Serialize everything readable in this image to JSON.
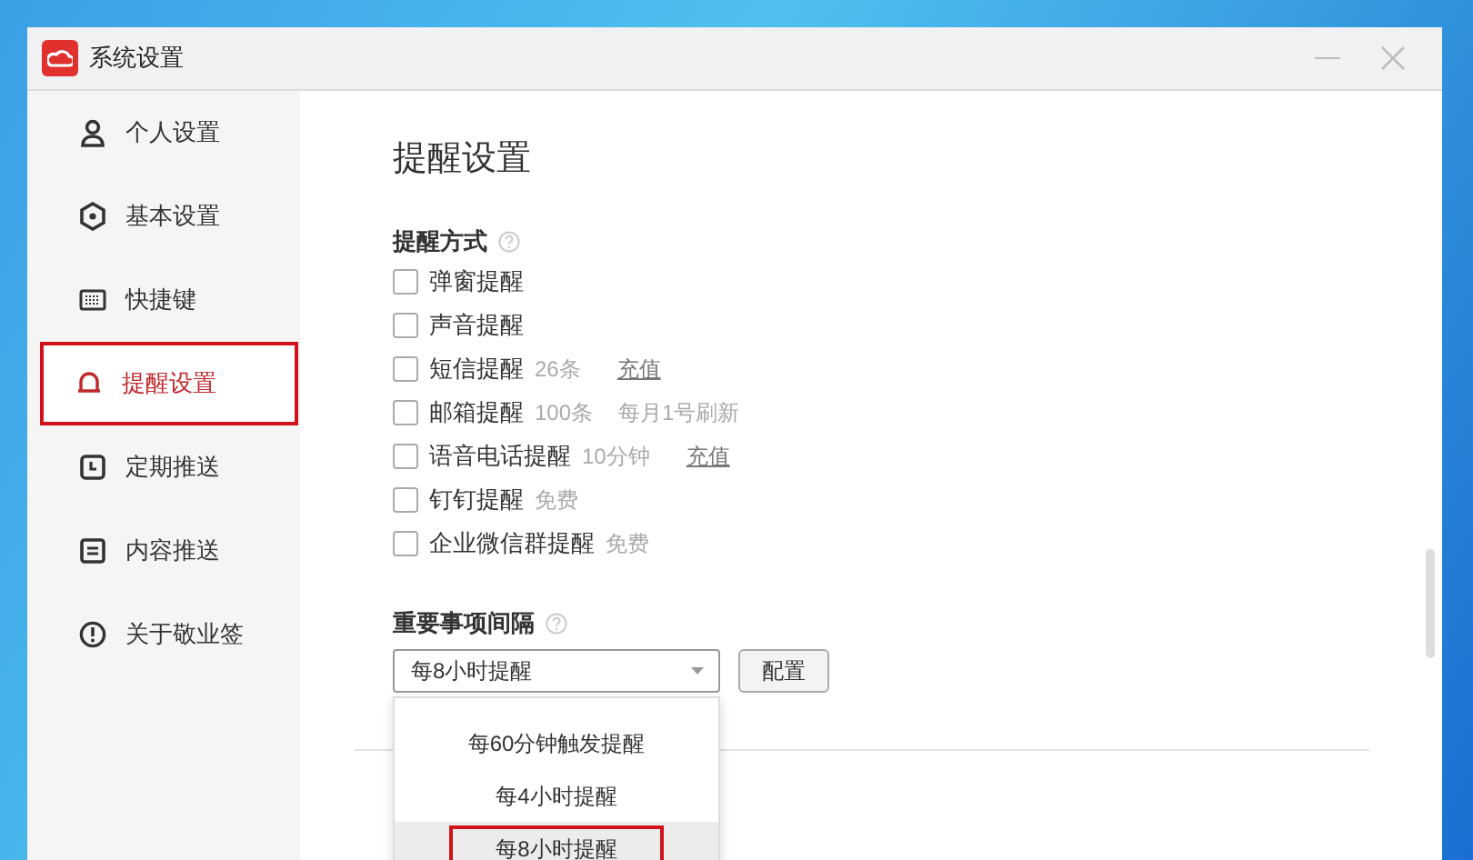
{
  "window": {
    "title": "系统设置"
  },
  "sidebar": {
    "items": [
      {
        "label": "个人设置",
        "selected": false
      },
      {
        "label": "基本设置",
        "selected": false
      },
      {
        "label": "快捷键",
        "selected": false
      },
      {
        "label": "提醒设置",
        "selected": true
      },
      {
        "label": "定期推送",
        "selected": false
      },
      {
        "label": "内容推送",
        "selected": false
      },
      {
        "label": "关于敬业签",
        "selected": false
      }
    ]
  },
  "page_title": "提醒设置",
  "methods": {
    "heading": "提醒方式",
    "options": [
      {
        "label": "弹窗提醒",
        "checked": false
      },
      {
        "label": "声音提醒",
        "checked": false
      },
      {
        "label": "短信提醒",
        "checked": false,
        "note": "26条",
        "link": "充值"
      },
      {
        "label": "邮箱提醒",
        "checked": false,
        "note": "100条",
        "note_2": "每月1号刷新"
      },
      {
        "label": "语音电话提醒",
        "checked": false,
        "note": "10分钟",
        "link": "充值"
      },
      {
        "label": "钉钉提醒",
        "checked": false,
        "note": "免费"
      },
      {
        "label": "企业微信群提醒",
        "checked": false,
        "note": "免费"
      }
    ]
  },
  "interval": {
    "heading": "重要事项间隔",
    "value": "每8小时提醒",
    "expanded": true,
    "button": "配置",
    "options": [
      {
        "label": "每60分钟触发提醒",
        "selected": false
      },
      {
        "label": "每4小时提醒",
        "selected": false
      },
      {
        "label": "每8小时提醒",
        "selected": true
      }
    ]
  }
}
